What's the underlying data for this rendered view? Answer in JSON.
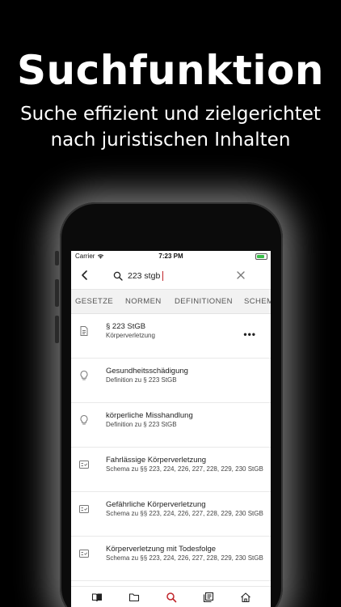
{
  "promo": {
    "title": "Suchfunktion",
    "subtitle_line1": "Suche effizient und zielgerichtet",
    "subtitle_line2": "nach juristischen Inhalten"
  },
  "status_bar": {
    "carrier": "Carrier",
    "time": "7:23 PM"
  },
  "search": {
    "value": "223 stgb"
  },
  "tabs": [
    "GESETZE",
    "NORMEN",
    "DEFINITIONEN",
    "SCHEM"
  ],
  "results": [
    {
      "icon": "document-icon",
      "title": "§ 223 StGB",
      "subtitle": "Körperverletzung",
      "more": "•••"
    },
    {
      "icon": "lightbulb-icon",
      "title": "Gesundheitsschädigung",
      "subtitle": "Definition zu § 223 StGB"
    },
    {
      "icon": "lightbulb-icon",
      "title": "körperliche Misshandlung",
      "subtitle": "Definition zu § 223 StGB"
    },
    {
      "icon": "schema-icon",
      "title": "Fahrlässige Körperverletzung",
      "subtitle": "Schema zu §§ 223, 224, 226, 227, 228, 229, 230 StGB"
    },
    {
      "icon": "schema-icon",
      "title": "Gefährliche Körperverletzung",
      "subtitle": "Schema zu §§ 223, 224, 226, 227, 228, 229, 230 StGB"
    },
    {
      "icon": "schema-icon",
      "title": "Körperverletzung mit Todesfolge",
      "subtitle": "Schema zu §§ 223, 224, 226, 227, 228, 229, 230 StGB"
    }
  ],
  "bottom_nav": [
    {
      "icon": "book-icon"
    },
    {
      "icon": "folder-icon"
    },
    {
      "icon": "search-icon",
      "active": true
    },
    {
      "icon": "library-icon"
    },
    {
      "icon": "home-icon"
    }
  ],
  "colors": {
    "accent": "#c0242a",
    "background": "#000000",
    "screen": "#ffffff"
  }
}
